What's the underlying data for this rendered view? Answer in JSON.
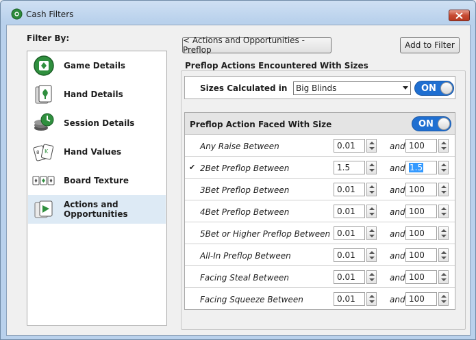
{
  "window": {
    "title": "Cash Filters"
  },
  "sidebar": {
    "heading": "Filter By:",
    "items": [
      {
        "label": "Game Details",
        "icon": "game-details-icon"
      },
      {
        "label": "Hand Details",
        "icon": "hand-details-icon"
      },
      {
        "label": "Session Details",
        "icon": "session-details-icon"
      },
      {
        "label": "Hand Values",
        "icon": "hand-values-icon"
      },
      {
        "label": "Board Texture",
        "icon": "board-texture-icon"
      },
      {
        "label": "Actions and Opportunities",
        "icon": "actions-opportunities-icon",
        "selected": true
      }
    ]
  },
  "toolbar": {
    "back_label": "< Actions and Opportunities - Preflop",
    "add_label": "Add to Filter"
  },
  "group": {
    "title": "Preflop Actions Encountered With Sizes",
    "sizes_label": "Sizes Calculated in",
    "sizes_value": "Big Blinds",
    "sizes_toggle": "ON"
  },
  "action": {
    "title": "Preflop Action Faced With Size",
    "toggle": "ON",
    "and_label": "and",
    "rows": [
      {
        "label": "Any Raise Between",
        "min": "0.01",
        "max": "100",
        "checked": false
      },
      {
        "label": "2Bet Preflop Between",
        "min": "1.5",
        "max": "1.5",
        "checked": true
      },
      {
        "label": "3Bet Preflop Between",
        "min": "0.01",
        "max": "100",
        "checked": false
      },
      {
        "label": "4Bet Preflop Between",
        "min": "0.01",
        "max": "100",
        "checked": false
      },
      {
        "label": "5Bet or Higher Preflop Between",
        "min": "0.01",
        "max": "100",
        "checked": false
      },
      {
        "label": "All-In Preflop Between",
        "min": "0.01",
        "max": "100",
        "checked": false
      },
      {
        "label": "Facing Steal Between",
        "min": "0.01",
        "max": "100",
        "checked": false
      },
      {
        "label": "Facing Squeeze Between",
        "min": "0.01",
        "max": "100",
        "checked": false
      }
    ]
  },
  "colors": {
    "accent": "#1f6fd1",
    "selection": "#3399ff",
    "close": "#c74a32"
  }
}
